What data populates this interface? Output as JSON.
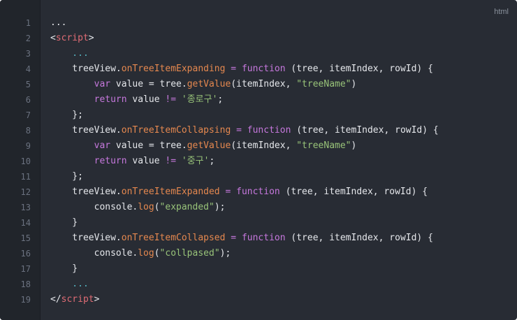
{
  "language_label": "html",
  "colors": {
    "background": "#282c34",
    "gutter": "#21252b",
    "line_number": "#6b7280",
    "text": "#e5e7eb",
    "keyword": "#c678dd",
    "function": "#e5884f",
    "string": "#98c379",
    "tag": "#e06c75"
  },
  "lines": [
    {
      "number": "1",
      "tokens": [
        {
          "t": "...",
          "c": "default"
        }
      ]
    },
    {
      "number": "2",
      "tokens": [
        {
          "t": "<",
          "c": "default"
        },
        {
          "t": "script",
          "c": "tag"
        },
        {
          "t": ">",
          "c": "default"
        }
      ]
    },
    {
      "number": "3",
      "tokens": [
        {
          "t": "    ...",
          "c": "dim"
        }
      ]
    },
    {
      "number": "4",
      "tokens": [
        {
          "t": "    treeView.",
          "c": "default"
        },
        {
          "t": "onTreeItemExpanding",
          "c": "prop"
        },
        {
          "t": " = ",
          "c": "op"
        },
        {
          "t": "function",
          "c": "kw"
        },
        {
          "t": " (tree, itemIndex, rowId) {",
          "c": "default"
        }
      ]
    },
    {
      "number": "5",
      "tokens": [
        {
          "t": "        ",
          "c": "default"
        },
        {
          "t": "var",
          "c": "kw"
        },
        {
          "t": " value = tree.",
          "c": "default"
        },
        {
          "t": "getValue",
          "c": "fn"
        },
        {
          "t": "(itemIndex, ",
          "c": "default"
        },
        {
          "t": "\"treeName\"",
          "c": "str"
        },
        {
          "t": ")",
          "c": "default"
        }
      ]
    },
    {
      "number": "6",
      "tokens": [
        {
          "t": "        ",
          "c": "default"
        },
        {
          "t": "return",
          "c": "kw"
        },
        {
          "t": " value ",
          "c": "default"
        },
        {
          "t": "!=",
          "c": "op"
        },
        {
          "t": " ",
          "c": "default"
        },
        {
          "t": "'종로구'",
          "c": "str"
        },
        {
          "t": ";",
          "c": "default"
        }
      ]
    },
    {
      "number": "7",
      "tokens": [
        {
          "t": "    };",
          "c": "default"
        }
      ]
    },
    {
      "number": "8",
      "tokens": [
        {
          "t": "    treeView.",
          "c": "default"
        },
        {
          "t": "onTreeItemCollapsing",
          "c": "prop"
        },
        {
          "t": " = ",
          "c": "op"
        },
        {
          "t": "function",
          "c": "kw"
        },
        {
          "t": " (tree, itemIndex, rowId) {",
          "c": "default"
        }
      ]
    },
    {
      "number": "9",
      "tokens": [
        {
          "t": "        ",
          "c": "default"
        },
        {
          "t": "var",
          "c": "kw"
        },
        {
          "t": " value = tree.",
          "c": "default"
        },
        {
          "t": "getValue",
          "c": "fn"
        },
        {
          "t": "(itemIndex, ",
          "c": "default"
        },
        {
          "t": "\"treeName\"",
          "c": "str"
        },
        {
          "t": ")",
          "c": "default"
        }
      ]
    },
    {
      "number": "10",
      "tokens": [
        {
          "t": "        ",
          "c": "default"
        },
        {
          "t": "return",
          "c": "kw"
        },
        {
          "t": " value ",
          "c": "default"
        },
        {
          "t": "!=",
          "c": "op"
        },
        {
          "t": " ",
          "c": "default"
        },
        {
          "t": "'중구'",
          "c": "str"
        },
        {
          "t": ";",
          "c": "default"
        }
      ]
    },
    {
      "number": "11",
      "tokens": [
        {
          "t": "    };",
          "c": "default"
        }
      ]
    },
    {
      "number": "12",
      "tokens": [
        {
          "t": "    treeView.",
          "c": "default"
        },
        {
          "t": "onTreeItemExpanded",
          "c": "prop"
        },
        {
          "t": " = ",
          "c": "op"
        },
        {
          "t": "function",
          "c": "kw"
        },
        {
          "t": " (tree, itemIndex, rowId) {",
          "c": "default"
        }
      ]
    },
    {
      "number": "13",
      "tokens": [
        {
          "t": "        console.",
          "c": "default"
        },
        {
          "t": "log",
          "c": "fn"
        },
        {
          "t": "(",
          "c": "default"
        },
        {
          "t": "\"expanded\"",
          "c": "str"
        },
        {
          "t": ");",
          "c": "default"
        }
      ]
    },
    {
      "number": "14",
      "tokens": [
        {
          "t": "    }",
          "c": "default"
        }
      ]
    },
    {
      "number": "15",
      "tokens": [
        {
          "t": "    treeView.",
          "c": "default"
        },
        {
          "t": "onTreeItemCollapsed",
          "c": "prop"
        },
        {
          "t": " = ",
          "c": "op"
        },
        {
          "t": "function",
          "c": "kw"
        },
        {
          "t": " (tree, itemIndex, rowId) {",
          "c": "default"
        }
      ]
    },
    {
      "number": "16",
      "tokens": [
        {
          "t": "        console.",
          "c": "default"
        },
        {
          "t": "log",
          "c": "fn"
        },
        {
          "t": "(",
          "c": "default"
        },
        {
          "t": "\"collpased\"",
          "c": "str"
        },
        {
          "t": ");",
          "c": "default"
        }
      ]
    },
    {
      "number": "17",
      "tokens": [
        {
          "t": "    }",
          "c": "default"
        }
      ]
    },
    {
      "number": "18",
      "tokens": [
        {
          "t": "    ...",
          "c": "dim"
        }
      ]
    },
    {
      "number": "19",
      "tokens": [
        {
          "t": "</",
          "c": "default"
        },
        {
          "t": "script",
          "c": "tag"
        },
        {
          "t": ">",
          "c": "default"
        }
      ]
    }
  ]
}
